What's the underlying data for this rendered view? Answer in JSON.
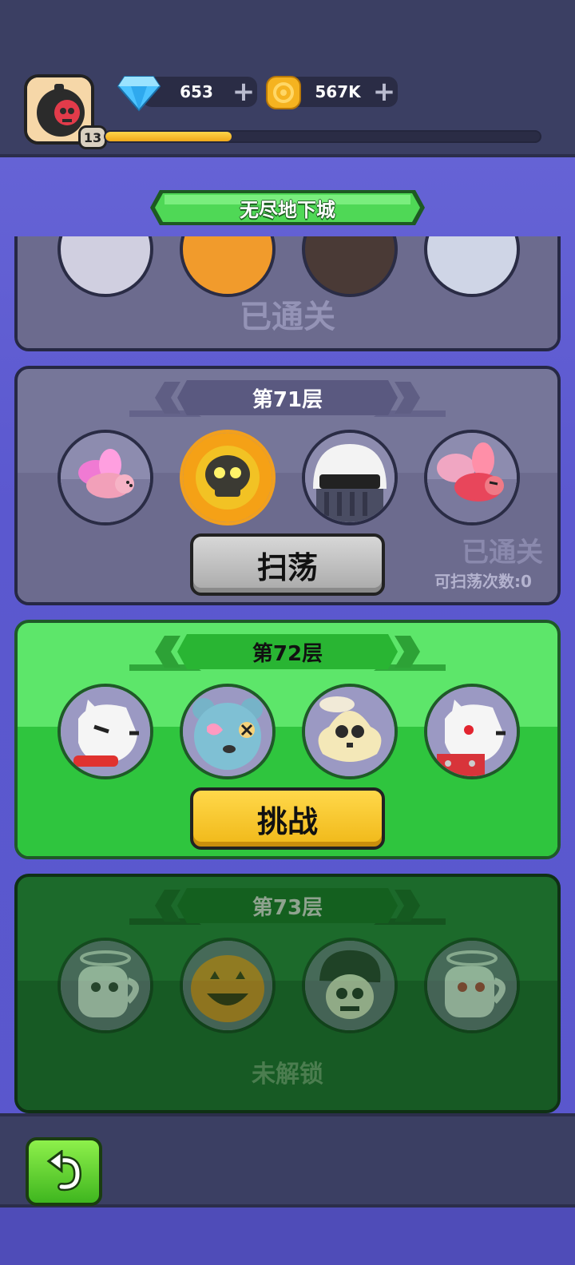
{
  "header": {
    "player_level": "13",
    "xp_progress": 0.29,
    "gems": {
      "value": "653",
      "icon": "diamond-icon",
      "add_icon": "plus-icon"
    },
    "coins": {
      "value": "567K",
      "icon": "gold-coin-icon",
      "add_icon": "plus-icon"
    }
  },
  "title": "无尽地下城",
  "floors": [
    {
      "status_label": "已通关"
    },
    {
      "title": "第71层",
      "button": "扫荡",
      "status_label": "已通关",
      "sweep_count": "可扫荡次数:0",
      "enemies": [
        "pink-fly-enemy-icon",
        "golden-skull-enemy-icon",
        "helmet-knight-enemy-icon",
        "red-fly-enemy-icon"
      ]
    },
    {
      "title": "第72层",
      "button": "挑战",
      "enemies": [
        "white-dog-enemy-icon",
        "zombie-bear-enemy-icon",
        "skull-enemy-icon",
        "armored-dog-enemy-icon"
      ]
    },
    {
      "title": "第73层",
      "status_label": "未解锁",
      "enemies": [
        "ghost-mug-enemy-icon",
        "pumpkin-enemy-icon",
        "skull-hair-enemy-icon",
        "ghost-mug-enemy-icon"
      ]
    }
  ],
  "footer": {
    "back_icon": "back-arrow-icon"
  },
  "colors": {
    "active_floor": "#5de66a",
    "cleared_floor": "#767699",
    "locked_floor": "#1c6a2b",
    "challenge_button": "#ffd84a"
  }
}
